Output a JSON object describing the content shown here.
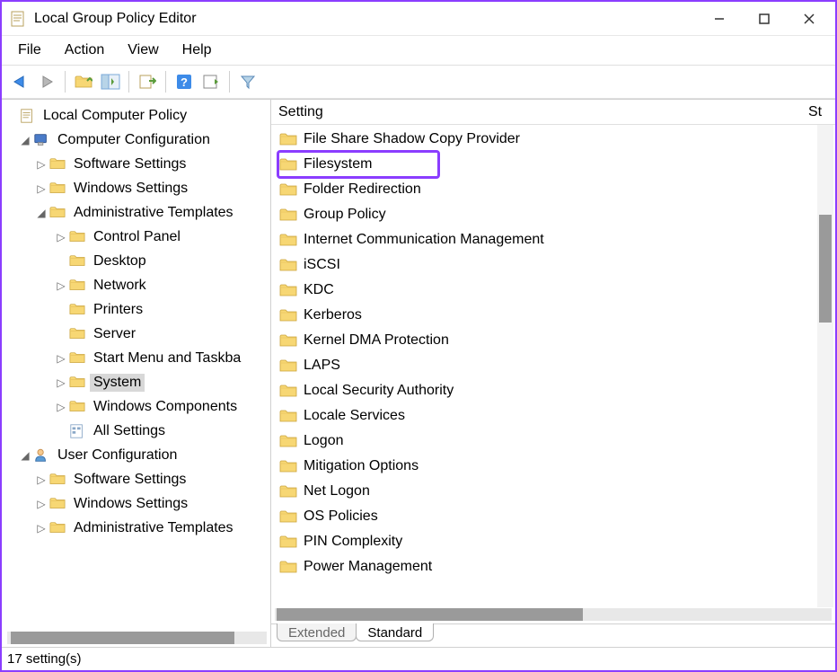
{
  "title": "Local Group Policy Editor",
  "menubar": [
    "File",
    "Action",
    "View",
    "Help"
  ],
  "tree": [
    {
      "indent": 0,
      "expander": "",
      "icon": "doc",
      "label": "Local Computer Policy",
      "selected": false
    },
    {
      "indent": 1,
      "expander": "v",
      "icon": "computer",
      "label": "Computer Configuration",
      "selected": false
    },
    {
      "indent": 2,
      "expander": ">",
      "icon": "folder",
      "label": "Software Settings",
      "selected": false
    },
    {
      "indent": 2,
      "expander": ">",
      "icon": "folder",
      "label": "Windows Settings",
      "selected": false
    },
    {
      "indent": 2,
      "expander": "v",
      "icon": "folder",
      "label": "Administrative Templates",
      "selected": false
    },
    {
      "indent": 3,
      "expander": ">",
      "icon": "folder",
      "label": "Control Panel",
      "selected": false
    },
    {
      "indent": 3,
      "expander": "",
      "icon": "folder",
      "label": "Desktop",
      "selected": false
    },
    {
      "indent": 3,
      "expander": ">",
      "icon": "folder",
      "label": "Network",
      "selected": false
    },
    {
      "indent": 3,
      "expander": "",
      "icon": "folder",
      "label": "Printers",
      "selected": false
    },
    {
      "indent": 3,
      "expander": "",
      "icon": "folder",
      "label": "Server",
      "selected": false
    },
    {
      "indent": 3,
      "expander": ">",
      "icon": "folder",
      "label": "Start Menu and Taskba",
      "selected": false
    },
    {
      "indent": 3,
      "expander": ">",
      "icon": "folder",
      "label": "System",
      "selected": true
    },
    {
      "indent": 3,
      "expander": ">",
      "icon": "folder",
      "label": "Windows Components",
      "selected": false
    },
    {
      "indent": 3,
      "expander": "",
      "icon": "allsettings",
      "label": "All Settings",
      "selected": false
    },
    {
      "indent": 1,
      "expander": "v",
      "icon": "user",
      "label": "User Configuration",
      "selected": false
    },
    {
      "indent": 2,
      "expander": ">",
      "icon": "folder",
      "label": "Software Settings",
      "selected": false
    },
    {
      "indent": 2,
      "expander": ">",
      "icon": "folder",
      "label": "Windows Settings",
      "selected": false
    },
    {
      "indent": 2,
      "expander": ">",
      "icon": "folder",
      "label": "Administrative Templates",
      "selected": false
    }
  ],
  "list": {
    "columns": {
      "setting": "Setting",
      "state": "St"
    },
    "items": [
      {
        "label": "File Share Shadow Copy Provider",
        "highlighted": false
      },
      {
        "label": "Filesystem",
        "highlighted": true
      },
      {
        "label": "Folder Redirection",
        "highlighted": false
      },
      {
        "label": "Group Policy",
        "highlighted": false
      },
      {
        "label": "Internet Communication Management",
        "highlighted": false
      },
      {
        "label": "iSCSI",
        "highlighted": false
      },
      {
        "label": "KDC",
        "highlighted": false
      },
      {
        "label": "Kerberos",
        "highlighted": false
      },
      {
        "label": "Kernel DMA Protection",
        "highlighted": false
      },
      {
        "label": "LAPS",
        "highlighted": false
      },
      {
        "label": "Local Security Authority",
        "highlighted": false
      },
      {
        "label": "Locale Services",
        "highlighted": false
      },
      {
        "label": "Logon",
        "highlighted": false
      },
      {
        "label": "Mitigation Options",
        "highlighted": false
      },
      {
        "label": "Net Logon",
        "highlighted": false
      },
      {
        "label": "OS Policies",
        "highlighted": false
      },
      {
        "label": "PIN Complexity",
        "highlighted": false
      },
      {
        "label": "Power Management",
        "highlighted": false
      }
    ]
  },
  "tabs": {
    "extended": "Extended",
    "standard": "Standard"
  },
  "statusbar": "17 setting(s)"
}
